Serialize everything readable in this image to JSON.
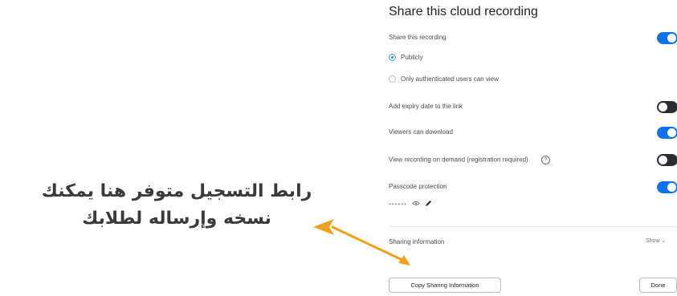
{
  "dialog": {
    "title": "Share this cloud recording",
    "share_recording_label": "Share this recording",
    "visibility_options": [
      {
        "label": "Publicly",
        "checked": true
      },
      {
        "label": "Only authenticated users can view",
        "checked": false
      }
    ],
    "settings": [
      {
        "label": "Add expiry date to the link",
        "enabled": false
      },
      {
        "label": "Viewers can download",
        "enabled": true
      },
      {
        "label": "View recording on demand (registration required)",
        "enabled": false
      },
      {
        "label": "Passcode protection",
        "enabled": true
      }
    ],
    "share_recording_enabled": true,
    "passcode_value": "••••••",
    "help_icon": "?",
    "eye_icon": "eye-icon",
    "edit_icon": "pencil-icon",
    "sharing_information_label": "Sharing information",
    "show_label": "Show",
    "copy_button": "Copy Sharing Information",
    "done_button": "Done"
  },
  "annotation": {
    "line1": "رابط التسجيل متوفر هنا يمكنك",
    "line2": "نسخه وإرساله لطلابك",
    "arrow_color": "#f0a020"
  },
  "colors": {
    "toggle_on": "#0e72ed",
    "toggle_off": "#2b2b33",
    "radio_selected": "#2d8cff"
  }
}
